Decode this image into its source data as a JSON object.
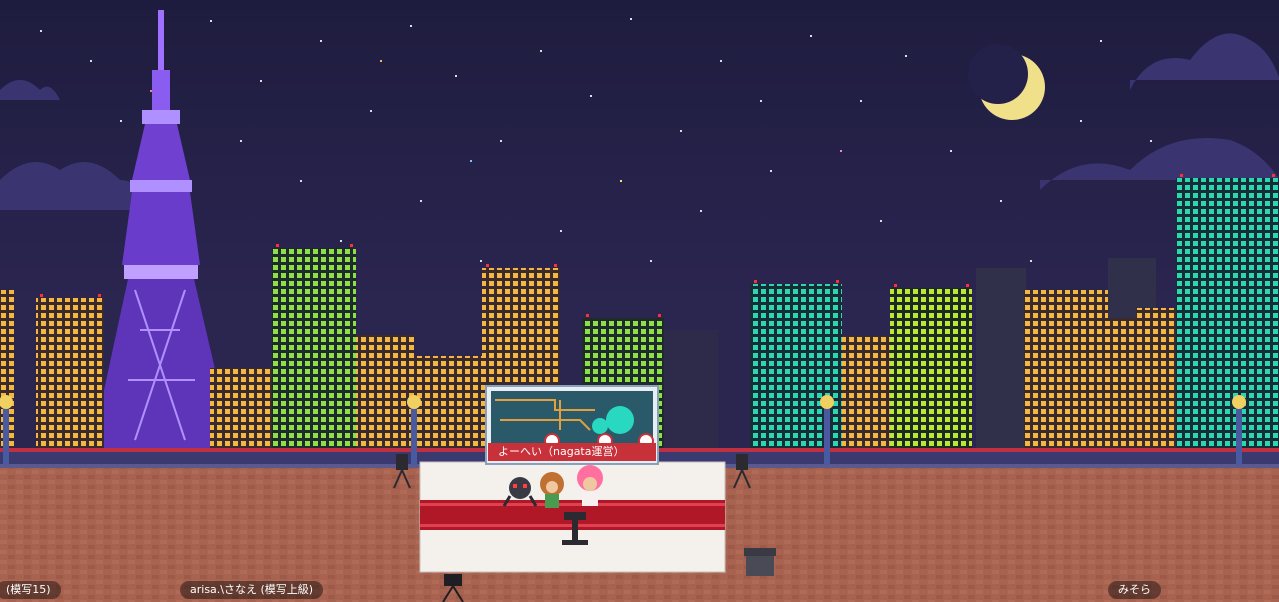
{
  "scene": {
    "name": "night-rooftop-city",
    "sky_color": "#23204a",
    "tower_color": "#8a5cf0",
    "floor_color": "#a86350"
  },
  "board": {
    "label": "よーへい（nagata運営）"
  },
  "nametags": {
    "left": "(模写15)",
    "middle": "arisa.\\さなえ (模写上級)",
    "right": "みそら"
  },
  "icons": [
    "moon-icon",
    "tower-icon",
    "podium-icon",
    "camera-icon",
    "speaker-icon",
    "lamp-icon",
    "stool-icon",
    "megaphone-icon"
  ]
}
